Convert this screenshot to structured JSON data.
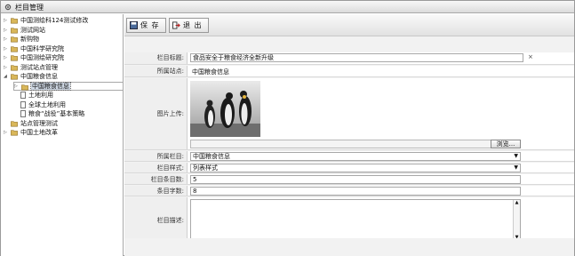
{
  "window": {
    "title": "栏目管理",
    "icon": "gear-icon"
  },
  "tree": {
    "nodes": [
      {
        "label": "中国测绘科124测试修改",
        "depth": 0,
        "expander": "▷",
        "kind": "folder"
      },
      {
        "label": "测试网站",
        "depth": 0,
        "expander": "▷",
        "kind": "folder"
      },
      {
        "label": "新购物",
        "depth": 0,
        "expander": "▷",
        "kind": "folder"
      },
      {
        "label": "中国科学研究院",
        "depth": 0,
        "expander": "▷",
        "kind": "folder"
      },
      {
        "label": "中国测绘研究院",
        "depth": 0,
        "expander": "▷",
        "kind": "folder"
      },
      {
        "label": "测试站点管理",
        "depth": 0,
        "expander": "▷",
        "kind": "folder"
      },
      {
        "label": "中国粮食信息",
        "depth": 0,
        "expander": "◢",
        "kind": "folder"
      },
      {
        "label": "中国粮食信息",
        "depth": 1,
        "expander": "▷",
        "kind": "folder",
        "selected": true
      },
      {
        "label": "土地利用",
        "depth": 1,
        "expander": "",
        "kind": "doc"
      },
      {
        "label": "全球土地利用",
        "depth": 1,
        "expander": "",
        "kind": "doc"
      },
      {
        "label": "粮食“战役”基本策略",
        "depth": 1,
        "expander": "",
        "kind": "doc"
      },
      {
        "label": "站点管理测试",
        "depth": 0,
        "expander": "",
        "kind": "folder"
      },
      {
        "label": "中国土地改革",
        "depth": 0,
        "expander": "▷",
        "kind": "folder"
      }
    ]
  },
  "toolbar": {
    "save_label": "保 存",
    "exit_label": "退 出"
  },
  "form": {
    "title_label": "栏目标题:",
    "title_value": "食品安全于粮食经济全新升级",
    "title_clear": "×",
    "site_label": "所属站点:",
    "site_value": "中国粮食信息",
    "image_label": "图片上传:",
    "browse_label": "浏览...",
    "column_label": "所属栏目:",
    "column_value": "中国粮食信息",
    "style_label": "栏目样式:",
    "style_value": "列表样式",
    "count_label": "栏目条目数:",
    "count_value": "5",
    "chars_label": "条目字数:",
    "chars_value": "8",
    "desc_label": "栏目描述:"
  },
  "colors": {
    "selection": "#cfd8e4",
    "label_bg": "#efefef",
    "folder": "#d9b75a"
  }
}
